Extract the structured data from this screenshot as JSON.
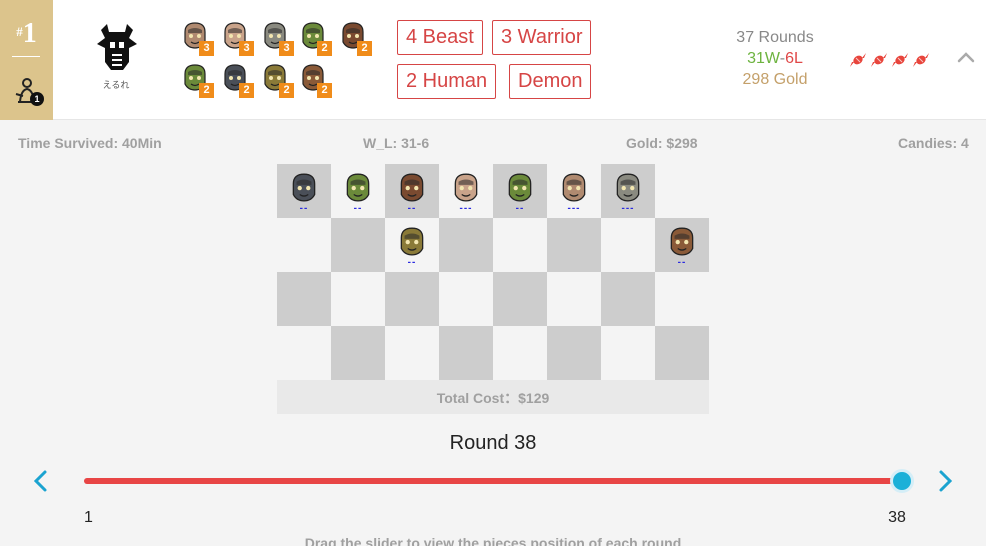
{
  "rank": {
    "hash": "#",
    "number": "1"
  },
  "player": {
    "badge": "1",
    "avatar_icon": "tribal-mask-icon",
    "name": "えるれ"
  },
  "lineup": [
    {
      "hero": "ogre-magi",
      "stars": "3",
      "color": "#b08a70"
    },
    {
      "hero": "juggernaut",
      "stars": "3",
      "color": "#c9a38a"
    },
    {
      "hero": "beastmaster",
      "stars": "3",
      "color": "#8a8a80"
    },
    {
      "hero": "venomancer",
      "stars": "2",
      "color": "#6b8a3a"
    },
    {
      "hero": "troll-warlord",
      "stars": "2",
      "color": "#7a4a30"
    },
    {
      "hero": "venomancer",
      "stars": "2",
      "color": "#6b8a3a"
    },
    {
      "hero": "abaddon",
      "stars": "2",
      "color": "#4a4f58"
    },
    {
      "hero": "broodmother",
      "stars": "2",
      "color": "#8a7a38"
    },
    {
      "hero": "kunkka",
      "stars": "2",
      "color": "#8a5a38"
    }
  ],
  "synergies": [
    "4 Beast",
    "3 Warrior",
    "2 Human",
    "Demon"
  ],
  "stats": {
    "rounds": "37 Rounds",
    "wins": "31W",
    "dash": "-",
    "losses": "6L",
    "gold": "298 Gold"
  },
  "candies": {
    "count": 4,
    "icon": "candy-icon",
    "color": "#e8453c"
  },
  "collapse_icon": "chevron-up-icon",
  "info": {
    "time": "Time Survived: 40Min",
    "wl": "W_L: 31-6",
    "gold": "Gold: $298",
    "candies": "Candies: 4"
  },
  "board": {
    "units": [
      {
        "hero": "abaddon",
        "row": 0,
        "col": 0,
        "stars": "--",
        "color": "#4a4f58"
      },
      {
        "hero": "venomancer",
        "row": 0,
        "col": 1,
        "stars": "--",
        "color": "#6b8a3a"
      },
      {
        "hero": "troll-warlord",
        "row": 0,
        "col": 2,
        "stars": "--",
        "color": "#7a4a30"
      },
      {
        "hero": "juggernaut",
        "row": 0,
        "col": 3,
        "stars": "---",
        "color": "#c9a38a"
      },
      {
        "hero": "venomancer",
        "row": 0,
        "col": 4,
        "stars": "--",
        "color": "#6b8a3a"
      },
      {
        "hero": "ogre-magi",
        "row": 0,
        "col": 5,
        "stars": "---",
        "color": "#b08a70"
      },
      {
        "hero": "beastmaster",
        "row": 0,
        "col": 6,
        "stars": "---",
        "color": "#8a8a80"
      },
      {
        "hero": "broodmother",
        "row": 1,
        "col": 2,
        "stars": "--",
        "color": "#8a7a38"
      },
      {
        "hero": "kunkka",
        "row": 1,
        "col": 7,
        "stars": "--",
        "color": "#8a5a38"
      }
    ],
    "total_cost": "Total Cost：$129"
  },
  "round": {
    "label": "Round 38",
    "value": 38,
    "min": 1,
    "max": 38,
    "min_label": "1",
    "max_label": "38"
  },
  "prev_icon": "chevron-left-icon",
  "next_icon": "chevron-right-icon",
  "hint": "Drag the slider to view the pieces position of each round"
}
